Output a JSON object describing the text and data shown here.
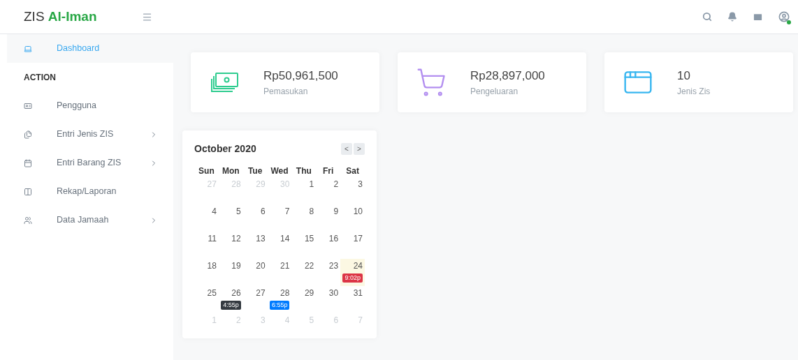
{
  "brand": {
    "prefix": "ZIS",
    "name": "Al-Iman"
  },
  "sidebar": {
    "items": [
      {
        "kind": "link",
        "label": "Dashboard",
        "selected": true,
        "has_submenu": false
      },
      {
        "kind": "heading",
        "label": "ACTION"
      },
      {
        "kind": "link",
        "label": "Pengguna",
        "selected": false,
        "has_submenu": false
      },
      {
        "kind": "link",
        "label": "Entri Jenis ZIS",
        "selected": false,
        "has_submenu": true
      },
      {
        "kind": "link",
        "label": "Entri Barang ZIS",
        "selected": false,
        "has_submenu": true
      },
      {
        "kind": "link",
        "label": "Rekap/Laporan",
        "selected": false,
        "has_submenu": false
      },
      {
        "kind": "link",
        "label": "Data Jamaah",
        "selected": false,
        "has_submenu": true
      }
    ]
  },
  "header": {
    "user_online": true
  },
  "stats": [
    {
      "value": "Rp50,961,500",
      "label": "Pemasukan"
    },
    {
      "value": "Rp28,897,000",
      "label": "Pengeluaran"
    },
    {
      "value": "10",
      "label": "Jenis Zis"
    }
  ],
  "calendar": {
    "title": "October 2020",
    "prev": "<",
    "next": ">",
    "weekdays": [
      "Sun",
      "Mon",
      "Tue",
      "Wed",
      "Thu",
      "Fri",
      "Sat"
    ],
    "weeks": [
      [
        {
          "day": "27",
          "muted": true
        },
        {
          "day": "28",
          "muted": true
        },
        {
          "day": "29",
          "muted": true
        },
        {
          "day": "30",
          "muted": true
        },
        {
          "day": "1",
          "muted": false
        },
        {
          "day": "2",
          "muted": false
        },
        {
          "day": "3",
          "muted": false
        }
      ],
      [
        {
          "day": "4",
          "muted": false
        },
        {
          "day": "5",
          "muted": false
        },
        {
          "day": "6",
          "muted": false
        },
        {
          "day": "7",
          "muted": false
        },
        {
          "day": "8",
          "muted": false
        },
        {
          "day": "9",
          "muted": false
        },
        {
          "day": "10",
          "muted": false
        }
      ],
      [
        {
          "day": "11",
          "muted": false
        },
        {
          "day": "12",
          "muted": false
        },
        {
          "day": "13",
          "muted": false
        },
        {
          "day": "14",
          "muted": false
        },
        {
          "day": "15",
          "muted": false
        },
        {
          "day": "16",
          "muted": false
        },
        {
          "day": "17",
          "muted": false
        }
      ],
      [
        {
          "day": "18",
          "muted": false
        },
        {
          "day": "19",
          "muted": false
        },
        {
          "day": "20",
          "muted": false
        },
        {
          "day": "21",
          "muted": false
        },
        {
          "day": "22",
          "muted": false
        },
        {
          "day": "23",
          "muted": false
        },
        {
          "day": "24",
          "muted": false,
          "today": true,
          "event": {
            "time": "9:02p",
            "color": "#dc3545"
          }
        }
      ],
      [
        {
          "day": "25",
          "muted": false
        },
        {
          "day": "26",
          "muted": false,
          "event": {
            "time": "4:55p",
            "color": "#343a40"
          }
        },
        {
          "day": "27",
          "muted": false
        },
        {
          "day": "28",
          "muted": false,
          "event": {
            "time": "6:55p",
            "color": "#007bff"
          }
        },
        {
          "day": "29",
          "muted": false
        },
        {
          "day": "30",
          "muted": false
        },
        {
          "day": "31",
          "muted": false
        }
      ],
      [
        {
          "day": "1",
          "muted": true
        },
        {
          "day": "2",
          "muted": true
        },
        {
          "day": "3",
          "muted": true
        },
        {
          "day": "4",
          "muted": true
        },
        {
          "day": "5",
          "muted": true
        },
        {
          "day": "6",
          "muted": true
        },
        {
          "day": "7",
          "muted": true
        }
      ]
    ]
  }
}
